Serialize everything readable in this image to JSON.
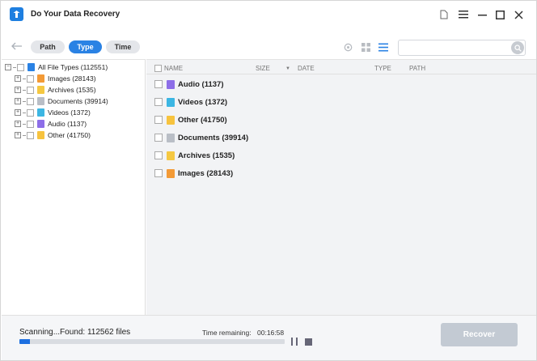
{
  "app": {
    "title": "Do Your Data Recovery"
  },
  "toolbar": {
    "tabs": [
      {
        "label": "Path",
        "active": false
      },
      {
        "label": "Type",
        "active": true
      },
      {
        "label": "Time",
        "active": false
      }
    ],
    "search": {
      "placeholder": "",
      "value": ""
    }
  },
  "tree": {
    "root": {
      "label": "All File Types (112551)"
    },
    "items": [
      {
        "label": "Images (28143)",
        "icon": "image-file-icon",
        "color": "#f39a36"
      },
      {
        "label": "Archives (1535)",
        "icon": "archive-file-icon",
        "color": "#f5c842"
      },
      {
        "label": "Documents (39914)",
        "icon": "document-file-icon",
        "color": "#b9bec6"
      },
      {
        "label": "Videos (1372)",
        "icon": "video-file-icon",
        "color": "#3cb6e3"
      },
      {
        "label": "Audio (1137)",
        "icon": "audio-file-icon",
        "color": "#8d6ee8"
      },
      {
        "label": "Other (41750)",
        "icon": "folder-icon",
        "color": "#f7c33e"
      }
    ]
  },
  "columns": {
    "name": "NAME",
    "size": "SIZE",
    "date": "DATE",
    "type": "TYPE",
    "path": "PATH"
  },
  "list": [
    {
      "label": "Audio (1137)",
      "icon": "audio-file-icon",
      "color": "#8d6ee8"
    },
    {
      "label": "Videos (1372)",
      "icon": "video-file-icon",
      "color": "#3cb6e3"
    },
    {
      "label": "Other (41750)",
      "icon": "folder-icon",
      "color": "#f7c33e"
    },
    {
      "label": "Documents (39914)",
      "icon": "document-file-icon",
      "color": "#b9bec6"
    },
    {
      "label": "Archives (1535)",
      "icon": "archive-file-icon",
      "color": "#f5c842"
    },
    {
      "label": "Images (28143)",
      "icon": "image-file-icon",
      "color": "#f39a36"
    }
  ],
  "status": {
    "scan_text": "Scanning...Found: 112562 files",
    "remaining_label": "Time remaining:",
    "remaining_time": "00:16:58",
    "progress_fraction": 0.04
  },
  "recover_label": "Recover",
  "colors": {
    "accent": "#2a82e4",
    "progress": "#1d6fe0",
    "recover_disabled": "#c3cad3"
  }
}
